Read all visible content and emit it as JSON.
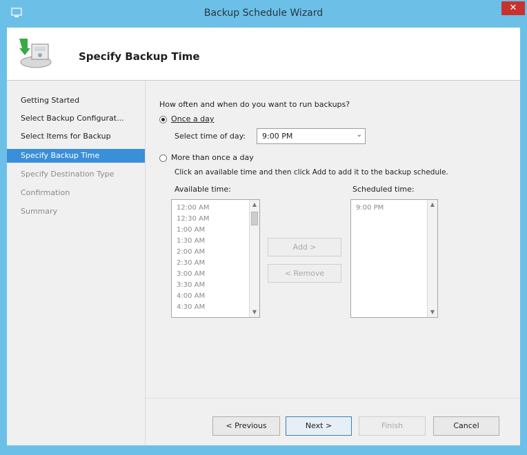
{
  "window": {
    "title": "Backup Schedule Wizard",
    "close_glyph": "✕",
    "app_icon": "server-backup-icon"
  },
  "header": {
    "title": "Specify Backup Time",
    "icon": "backup-wizard-icon"
  },
  "nav": {
    "items": [
      {
        "label": "Getting Started",
        "state": "done"
      },
      {
        "label": "Select Backup Configurat...",
        "state": "done"
      },
      {
        "label": "Select Items for Backup",
        "state": "done"
      },
      {
        "label": "Specify Backup Time",
        "state": "active"
      },
      {
        "label": "Specify Destination Type",
        "state": "pending"
      },
      {
        "label": "Confirmation",
        "state": "pending"
      },
      {
        "label": "Summary",
        "state": "pending"
      }
    ]
  },
  "content": {
    "question": "How often and when do you want to run backups?",
    "once": {
      "label": "Once a day",
      "selected": true,
      "time_label": "Select time of day:",
      "time_value": "9:00 PM"
    },
    "more": {
      "label": "More than once a day",
      "selected": false,
      "instruction": "Click an available time and then click Add to add it to the backup schedule."
    },
    "available": {
      "label": "Available time:",
      "items": [
        "12:00 AM",
        "12:30 AM",
        "1:00 AM",
        "1:30 AM",
        "2:00 AM",
        "2:30 AM",
        "3:00 AM",
        "3:30 AM",
        "4:00 AM",
        "4:30 AM"
      ]
    },
    "scheduled": {
      "label": "Scheduled time:",
      "items": [
        "9:00 PM"
      ]
    },
    "add_button": "Add >",
    "remove_button": "< Remove"
  },
  "footer": {
    "previous": "< Previous",
    "next": "Next >",
    "finish": "Finish",
    "cancel": "Cancel"
  }
}
